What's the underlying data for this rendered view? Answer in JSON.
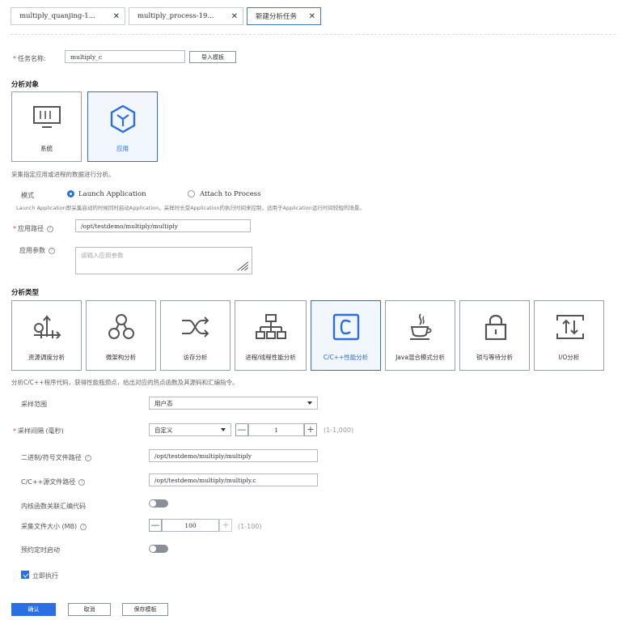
{
  "tabs": [
    {
      "label": "multiply_quanjing-1...",
      "active": false
    },
    {
      "label": "multiply_process-19...",
      "active": false
    },
    {
      "label": "新建分析任务",
      "active": true
    }
  ],
  "task": {
    "name_label": "任务名称:",
    "name_value": "multiply_c",
    "import_button": "导入模板"
  },
  "analysis_object": {
    "section_title": "分析对象",
    "cards": [
      {
        "label": "系统",
        "icon": "monitor-icon",
        "selected": false
      },
      {
        "label": "应用",
        "icon": "cube-icon",
        "selected": true
      }
    ],
    "description": "采集指定应用或进程的数据进行分析。"
  },
  "mode": {
    "label": "模式",
    "options": [
      "Launch Application",
      "Attach to Process"
    ],
    "selected": "Launch Application",
    "hint": "Launch Application即采集启动的时候同时启动Application，采样时长受Application的执行时间来控制，适用于Application运行时间较短的场景。"
  },
  "app_path": {
    "label": "应用路径",
    "value": "/opt/testdemo/multiply/multiply"
  },
  "app_params": {
    "label": "应用参数",
    "placeholder": "请输入应用参数"
  },
  "analysis_type": {
    "section_title": "分析类型",
    "cards": [
      {
        "label": "资源调度分析",
        "icon": "resource-schedule-icon"
      },
      {
        "label": "微架构分析",
        "icon": "micro-architecture-icon"
      },
      {
        "label": "访存分析",
        "icon": "memory-access-icon"
      },
      {
        "label": "进程/线程性能分析",
        "icon": "process-thread-icon"
      },
      {
        "label": "C/C++性能分析",
        "icon": "c-language-icon"
      },
      {
        "label": "Java混合模式分析",
        "icon": "java-icon"
      },
      {
        "label": "锁与等待分析",
        "icon": "lock-icon"
      },
      {
        "label": "I/O分析",
        "icon": "io-icon"
      }
    ],
    "selected": "C/C++性能分析",
    "description": "分析C/C++程序代码，获得性能瓶颈点，给出对应的热点函数及其源码和汇编指令。"
  },
  "form": {
    "sample_range": {
      "label": "采样范围",
      "value": "用户态"
    },
    "sample_interval": {
      "label": "采样间隔 (毫秒)",
      "mode": "自定义",
      "minus": "—",
      "value": "1",
      "plus": "+",
      "range": "(1-1,000)"
    },
    "binary_path": {
      "label": "二进制/符号文件路径",
      "value": "/opt/testdemo/multiply/multiply"
    },
    "source_path": {
      "label": "C/C++源文件路径",
      "value": "/opt/testdemo/multiply/multiply.c"
    },
    "kernel_asm": {
      "label": "内核函数关联汇编代码",
      "on": false
    },
    "file_size": {
      "label": "采集文件大小 (MB)",
      "minus": "—",
      "value": "100",
      "plus": "+",
      "range": "(1-100)"
    },
    "scheduled": {
      "label": "预约定时启动",
      "on": false
    },
    "run_now": {
      "label": "立即执行",
      "checked": true
    }
  },
  "actions": {
    "confirm": "确认",
    "cancel": "取消",
    "save_template": "保存模板"
  },
  "colors": {
    "accent": "#2b6fe0",
    "required": "#e04040"
  }
}
